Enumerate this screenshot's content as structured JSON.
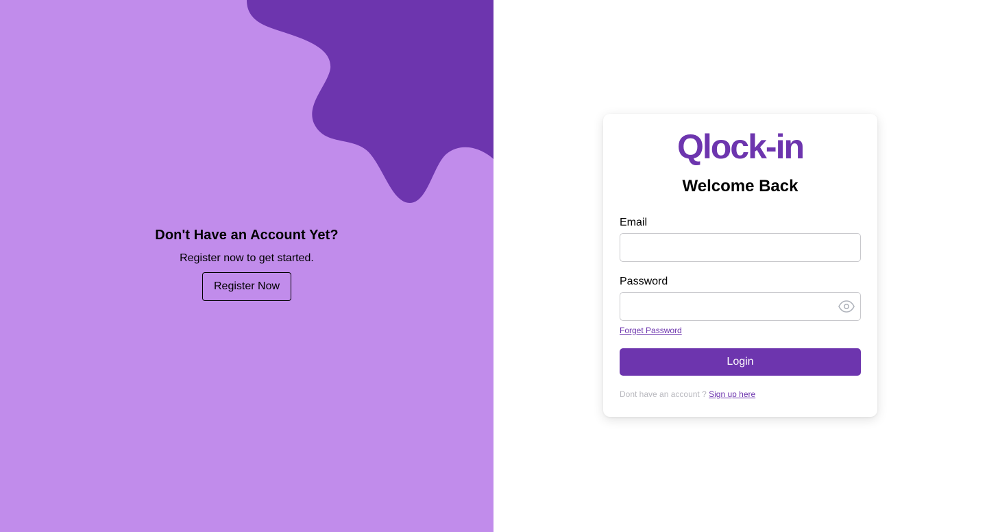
{
  "left_panel": {
    "title": "Don't Have an Account Yet?",
    "subtitle": "Register now to get started.",
    "register_label": "Register Now",
    "bg_color": "#c18ceb",
    "blob_color": "#6d35ae"
  },
  "login_card": {
    "logo_text": "Qlock-in",
    "heading": "Welcome Back",
    "email_label": "Email",
    "email_value": "",
    "password_label": "Password",
    "password_value": "",
    "password_toggle_icon": "eye-icon",
    "forgot_label": "Forget Password",
    "login_label": "Login",
    "signup_prompt": "Dont have an account ?",
    "signup_link": "Sign up here",
    "accent_color": "#6d35ae"
  }
}
